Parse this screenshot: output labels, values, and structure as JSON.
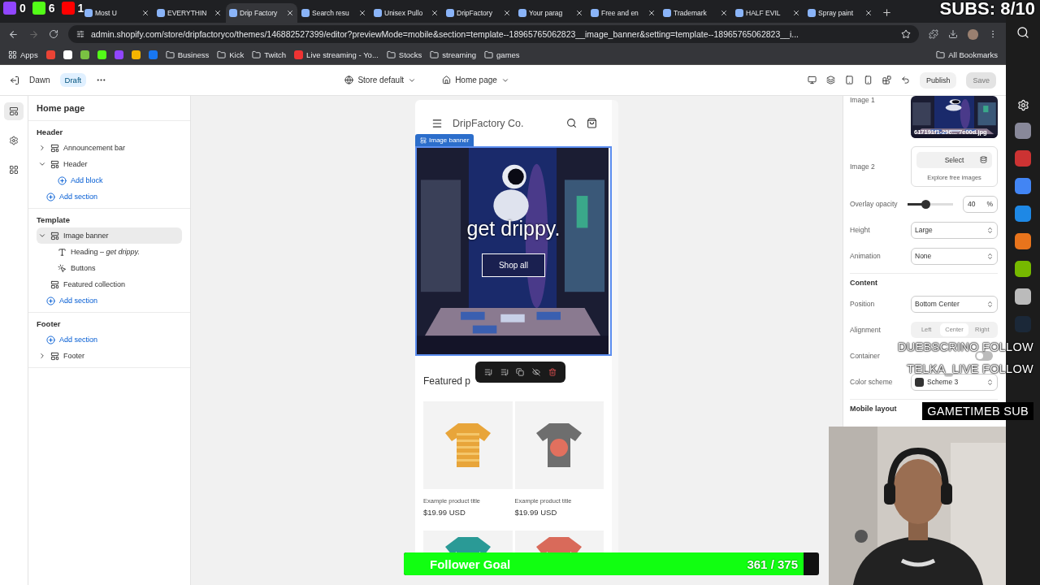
{
  "browser": {
    "tabs": [
      {
        "label": "Most U",
        "selected": false
      },
      {
        "label": "EVERYTHIN",
        "selected": false
      },
      {
        "label": "Drip Factory",
        "selected": true
      },
      {
        "label": "Search resu",
        "selected": false
      },
      {
        "label": "Unisex Pullo",
        "selected": false
      },
      {
        "label": "DripFactory",
        "selected": false
      },
      {
        "label": "Your parag",
        "selected": false
      },
      {
        "label": "Free and en",
        "selected": false
      },
      {
        "label": "Trademark",
        "selected": false
      },
      {
        "label": "HALF EVIL",
        "selected": false
      },
      {
        "label": "Spray paint",
        "selected": false
      }
    ],
    "url": "admin.shopify.com/store/dripfactoryco/themes/146882527399/editor?previewMode=mobile&section=template--18965765062823__image_banner&setting=template--18965765062823__i...",
    "bookmarks": [
      {
        "kind": "apps",
        "label": "Apps"
      },
      {
        "kind": "folder",
        "label": "Business"
      },
      {
        "kind": "folder",
        "label": "Kick"
      },
      {
        "kind": "folder",
        "label": "Twitch"
      },
      {
        "kind": "link",
        "label": "Live streaming - Yo..."
      },
      {
        "kind": "folder",
        "label": "Stocks"
      },
      {
        "kind": "folder",
        "label": "streaming"
      },
      {
        "kind": "folder",
        "label": "games"
      },
      {
        "kind": "folder",
        "label": "All Bookmarks"
      }
    ]
  },
  "editor": {
    "theme": "Dawn",
    "status": "Draft",
    "selectors": [
      {
        "kind": "globe",
        "label": "Store default"
      },
      {
        "kind": "home",
        "label": "Home page"
      }
    ],
    "buttons": [
      {
        "label": "Publish",
        "disabled": false
      },
      {
        "label": "Save",
        "disabled": true
      }
    ]
  },
  "sidebar": {
    "title": "Home page",
    "groups": [
      {
        "title": "Header",
        "items": [
          {
            "kind": "section",
            "label": "Announcement bar",
            "expanded": false,
            "selected": false
          },
          {
            "kind": "section",
            "label": "Header",
            "expanded": true,
            "selected": false,
            "children": [
              {
                "kind": "add",
                "label": "Add block"
              }
            ]
          },
          {
            "kind": "add",
            "label": "Add section"
          }
        ]
      },
      {
        "title": "Template",
        "items": [
          {
            "kind": "section",
            "label": "Image banner",
            "expanded": true,
            "selected": true,
            "children": [
              {
                "kind": "heading",
                "label": "Heading – *get drippy.*"
              },
              {
                "kind": "buttons",
                "label": "Buttons"
              }
            ]
          },
          {
            "kind": "section",
            "label": "Featured collection",
            "selected": false
          },
          {
            "kind": "add",
            "label": "Add section"
          }
        ]
      },
      {
        "title": "Footer",
        "items": [
          {
            "kind": "add",
            "label": "Add section"
          },
          {
            "kind": "section",
            "label": "Footer",
            "expanded": false,
            "selected": false
          }
        ]
      }
    ]
  },
  "preview": {
    "store_name": "DripFactory Co.",
    "banner_tag": "Image banner",
    "heading": "get drippy.",
    "button": "Shop all",
    "featured_title": "Featured p",
    "products": [
      {
        "title": "Example product title",
        "price": "$19.99 USD",
        "kind": "stripes"
      },
      {
        "title": "Example product title",
        "price": "$19.99 USD",
        "kind": "sun"
      },
      {
        "kind": "teal"
      },
      {
        "kind": "red"
      }
    ]
  },
  "settings": [
    {
      "label": "Image 1",
      "filename": "617191f1-29c... 7e00d.jpg"
    },
    {
      "kind": "picker",
      "label": "Image 2",
      "button": "Select",
      "link": "Explore free images"
    },
    {
      "kind": "slider",
      "label": "Overlay opacity",
      "level": 0.4,
      "value": "40",
      "unit": "%"
    },
    {
      "kind": "select",
      "label": "Height",
      "value": "Large"
    },
    {
      "kind": "select",
      "label": "Animation",
      "value": "None"
    },
    {
      "kind": "heading",
      "label": "Content"
    },
    {
      "kind": "select",
      "label": "Position",
      "value": "Bottom Center"
    },
    {
      "kind": "segmented",
      "label": "Alignment",
      "options": [
        {
          "label": "Left",
          "selected": false
        },
        {
          "label": "Center",
          "selected": true
        },
        {
          "label": "Right",
          "selected": false
        }
      ]
    },
    {
      "kind": "toggle",
      "label": "Container",
      "on": false
    },
    {
      "kind": "scheme",
      "label": "Color scheme",
      "value": "Scheme 3"
    },
    {
      "kind": "heading",
      "label": "Mobile layout"
    }
  ],
  "stream": {
    "subs": "SUBS: 8/10",
    "counters": [
      {
        "kind": "twitch",
        "count": "0"
      },
      {
        "kind": "kick",
        "count": "6"
      },
      {
        "kind": "youtube",
        "count": "1"
      }
    ],
    "alerts": [
      {
        "kind": "follow",
        "name": "DUEBSCRINO",
        "action": "FOLLOW"
      },
      {
        "kind": "follow",
        "name": "TELKA_LIVE",
        "action": "FOLLOW"
      },
      {
        "kind": "sub",
        "name": "GAMETIMEB",
        "action": "SUB"
      }
    ],
    "goal": {
      "label": "Follower Goal",
      "reading": "361 / 375",
      "level": 0.963
    }
  }
}
